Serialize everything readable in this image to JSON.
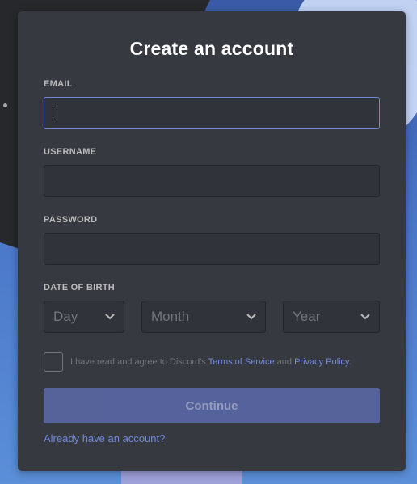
{
  "form": {
    "title": "Create an account",
    "email_label": "EMAIL",
    "email_value": "",
    "username_label": "USERNAME",
    "username_value": "",
    "password_label": "PASSWORD",
    "password_value": "",
    "dob_label": "DATE OF BIRTH",
    "dob_day": "Day",
    "dob_month": "Month",
    "dob_year": "Year",
    "agree_prefix": "I have read and agree to Discord's",
    "terms_link": "Terms of Service",
    "agree_and": "and",
    "privacy_link": "Privacy Policy",
    "agree_suffix": ".",
    "continue_label": "Continue",
    "login_link": "Already have an account?"
  },
  "icons": {
    "dropdown": "chevron-down-icon"
  },
  "colors": {
    "card_bg": "#36393f",
    "accent": "#7289da",
    "button": "#5865a0"
  }
}
